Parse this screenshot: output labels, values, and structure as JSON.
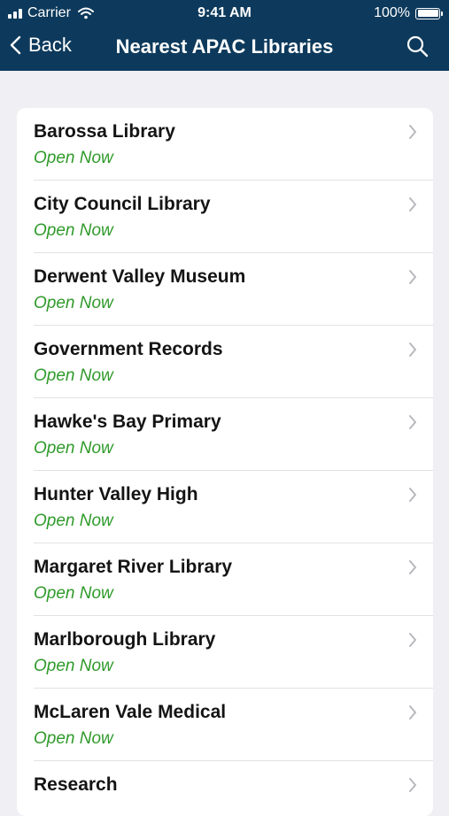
{
  "status_bar": {
    "carrier": "Carrier",
    "time": "9:41 AM",
    "battery": "100%"
  },
  "nav": {
    "back_label": "Back",
    "title": "Nearest APAC Libraries"
  },
  "colors": {
    "header": "#0d3a5c",
    "open_status": "#2f9a2a",
    "background": "#f0eff4"
  },
  "libraries": [
    {
      "name": "Barossa Library",
      "status": "Open Now"
    },
    {
      "name": "City Council Library",
      "status": "Open Now"
    },
    {
      "name": "Derwent Valley Museum",
      "status": "Open Now"
    },
    {
      "name": "Government Records",
      "status": "Open Now"
    },
    {
      "name": "Hawke's Bay Primary",
      "status": "Open Now"
    },
    {
      "name": "Hunter Valley High",
      "status": "Open Now"
    },
    {
      "name": "Margaret River Library",
      "status": "Open Now"
    },
    {
      "name": "Marlborough Library",
      "status": "Open Now"
    },
    {
      "name": "McLaren Vale Medical",
      "status": "Open Now"
    },
    {
      "name": "Research",
      "status": ""
    }
  ]
}
